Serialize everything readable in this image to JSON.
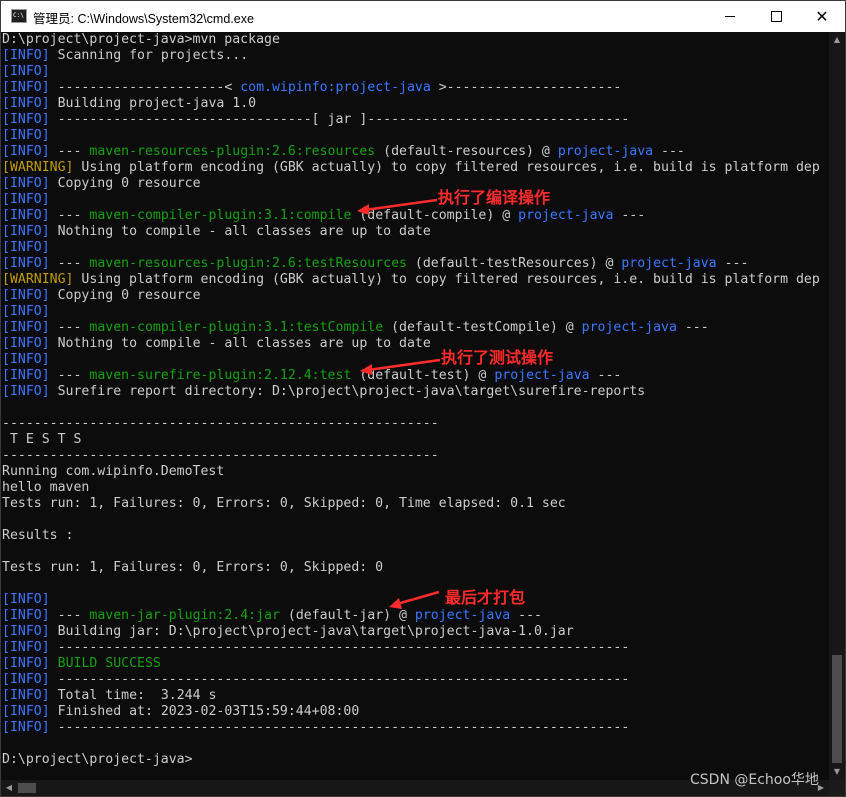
{
  "window": {
    "title": "管理员: C:\\Windows\\System32\\cmd.exe",
    "icon": "cmd-icon",
    "icon_text": "C:\\"
  },
  "colors": {
    "info_tag": "#3b78ff",
    "warning_tag": "#c19c00",
    "plugin_green": "#13a10e",
    "project_blue": "#3b78ff",
    "default_text": "#cccccc",
    "annotation_red": "#ff2b2b"
  },
  "console": {
    "lines": [
      [
        [
          "plain",
          "D:\\project\\project-java>mvn package"
        ]
      ],
      [
        [
          "bracket",
          "["
        ],
        [
          "tag",
          "INFO"
        ],
        [
          "bracket",
          "]"
        ],
        [
          "plain",
          " Scanning for projects..."
        ]
      ],
      [
        [
          "bracket",
          "["
        ],
        [
          "tag",
          "INFO"
        ],
        [
          "bracket",
          "]"
        ]
      ],
      [
        [
          "bracket",
          "["
        ],
        [
          "tag",
          "INFO"
        ],
        [
          "bracket",
          "]"
        ],
        [
          "plain",
          " ---------------------< "
        ],
        [
          "blue",
          "com.wipinfo:project-java"
        ],
        [
          "plain",
          " >----------------------"
        ]
      ],
      [
        [
          "bracket",
          "["
        ],
        [
          "tag",
          "INFO"
        ],
        [
          "bracket",
          "]"
        ],
        [
          "plain",
          " Building project-java 1.0"
        ]
      ],
      [
        [
          "bracket",
          "["
        ],
        [
          "tag",
          "INFO"
        ],
        [
          "bracket",
          "]"
        ],
        [
          "plain",
          " --------------------------------[ jar ]---------------------------------"
        ]
      ],
      [
        [
          "bracket",
          "["
        ],
        [
          "tag",
          "INFO"
        ],
        [
          "bracket",
          "]"
        ]
      ],
      [
        [
          "bracket",
          "["
        ],
        [
          "tag",
          "INFO"
        ],
        [
          "bracket",
          "]"
        ],
        [
          "plain",
          " --- "
        ],
        [
          "green",
          "maven-resources-plugin:2.6:resources"
        ],
        [
          "plain",
          " (default-resources) @ "
        ],
        [
          "blue",
          "project-java"
        ],
        [
          "plain",
          " ---"
        ]
      ],
      [
        [
          "warn",
          "[WARNING]"
        ],
        [
          "plain",
          " Using platform encoding (GBK actually) to copy filtered resources, i.e. build is platform dep"
        ]
      ],
      [
        [
          "bracket",
          "["
        ],
        [
          "tag",
          "INFO"
        ],
        [
          "bracket",
          "]"
        ],
        [
          "plain",
          " Copying 0 resource"
        ]
      ],
      [
        [
          "bracket",
          "["
        ],
        [
          "tag",
          "INFO"
        ],
        [
          "bracket",
          "]"
        ]
      ],
      [
        [
          "bracket",
          "["
        ],
        [
          "tag",
          "INFO"
        ],
        [
          "bracket",
          "]"
        ],
        [
          "plain",
          " --- "
        ],
        [
          "green",
          "maven-compiler-plugin:3.1:compile"
        ],
        [
          "plain",
          " (default-compile) @ "
        ],
        [
          "blue",
          "project-java"
        ],
        [
          "plain",
          " ---"
        ]
      ],
      [
        [
          "bracket",
          "["
        ],
        [
          "tag",
          "INFO"
        ],
        [
          "bracket",
          "]"
        ],
        [
          "plain",
          " Nothing to compile - all classes are up to date"
        ]
      ],
      [
        [
          "bracket",
          "["
        ],
        [
          "tag",
          "INFO"
        ],
        [
          "bracket",
          "]"
        ]
      ],
      [
        [
          "bracket",
          "["
        ],
        [
          "tag",
          "INFO"
        ],
        [
          "bracket",
          "]"
        ],
        [
          "plain",
          " --- "
        ],
        [
          "green",
          "maven-resources-plugin:2.6:testResources"
        ],
        [
          "plain",
          " (default-testResources) @ "
        ],
        [
          "blue",
          "project-java"
        ],
        [
          "plain",
          " ---"
        ]
      ],
      [
        [
          "warn",
          "[WARNING]"
        ],
        [
          "plain",
          " Using platform encoding (GBK actually) to copy filtered resources, i.e. build is platform dep"
        ]
      ],
      [
        [
          "bracket",
          "["
        ],
        [
          "tag",
          "INFO"
        ],
        [
          "bracket",
          "]"
        ],
        [
          "plain",
          " Copying 0 resource"
        ]
      ],
      [
        [
          "bracket",
          "["
        ],
        [
          "tag",
          "INFO"
        ],
        [
          "bracket",
          "]"
        ]
      ],
      [
        [
          "bracket",
          "["
        ],
        [
          "tag",
          "INFO"
        ],
        [
          "bracket",
          "]"
        ],
        [
          "plain",
          " --- "
        ],
        [
          "green",
          "maven-compiler-plugin:3.1:testCompile"
        ],
        [
          "plain",
          " (default-testCompile) @ "
        ],
        [
          "blue",
          "project-java"
        ],
        [
          "plain",
          " ---"
        ]
      ],
      [
        [
          "bracket",
          "["
        ],
        [
          "tag",
          "INFO"
        ],
        [
          "bracket",
          "]"
        ],
        [
          "plain",
          " Nothing to compile - all classes are up to date"
        ]
      ],
      [
        [
          "bracket",
          "["
        ],
        [
          "tag",
          "INFO"
        ],
        [
          "bracket",
          "]"
        ]
      ],
      [
        [
          "bracket",
          "["
        ],
        [
          "tag",
          "INFO"
        ],
        [
          "bracket",
          "]"
        ],
        [
          "plain",
          " --- "
        ],
        [
          "green",
          "maven-surefire-plugin:2.12.4:test"
        ],
        [
          "plain",
          " (default-test) @ "
        ],
        [
          "blue",
          "project-java"
        ],
        [
          "plain",
          " ---"
        ]
      ],
      [
        [
          "bracket",
          "["
        ],
        [
          "tag",
          "INFO"
        ],
        [
          "bracket",
          "]"
        ],
        [
          "plain",
          " Surefire report directory: D:\\project\\project-java\\target\\surefire-reports"
        ]
      ],
      [],
      [
        [
          "plain",
          "-------------------------------------------------------"
        ]
      ],
      [
        [
          "plain",
          " T E S T S"
        ]
      ],
      [
        [
          "plain",
          "-------------------------------------------------------"
        ]
      ],
      [
        [
          "plain",
          "Running com.wipinfo.DemoTest"
        ]
      ],
      [
        [
          "plain",
          "hello maven"
        ]
      ],
      [
        [
          "plain",
          "Tests run: 1, Failures: 0, Errors: 0, Skipped: 0, Time elapsed: 0.1 sec"
        ]
      ],
      [],
      [
        [
          "plain",
          "Results :"
        ]
      ],
      [],
      [
        [
          "plain",
          "Tests run: 1, Failures: 0, Errors: 0, Skipped: 0"
        ]
      ],
      [],
      [
        [
          "bracket",
          "["
        ],
        [
          "tag",
          "INFO"
        ],
        [
          "bracket",
          "]"
        ]
      ],
      [
        [
          "bracket",
          "["
        ],
        [
          "tag",
          "INFO"
        ],
        [
          "bracket",
          "]"
        ],
        [
          "plain",
          " --- "
        ],
        [
          "green",
          "maven-jar-plugin:2.4:jar"
        ],
        [
          "plain",
          " (default-jar) @ "
        ],
        [
          "blue",
          "project-java"
        ],
        [
          "plain",
          " ---"
        ]
      ],
      [
        [
          "bracket",
          "["
        ],
        [
          "tag",
          "INFO"
        ],
        [
          "bracket",
          "]"
        ],
        [
          "plain",
          " Building jar: D:\\project\\project-java\\target\\project-java-1.0.jar"
        ]
      ],
      [
        [
          "bracket",
          "["
        ],
        [
          "tag",
          "INFO"
        ],
        [
          "bracket",
          "]"
        ],
        [
          "plain",
          " ------------------------------------------------------------------------"
        ]
      ],
      [
        [
          "bracket",
          "["
        ],
        [
          "tag",
          "INFO"
        ],
        [
          "bracket",
          "]"
        ],
        [
          "plain",
          " "
        ],
        [
          "green",
          "BUILD SUCCESS"
        ]
      ],
      [
        [
          "bracket",
          "["
        ],
        [
          "tag",
          "INFO"
        ],
        [
          "bracket",
          "]"
        ],
        [
          "plain",
          " ------------------------------------------------------------------------"
        ]
      ],
      [
        [
          "bracket",
          "["
        ],
        [
          "tag",
          "INFO"
        ],
        [
          "bracket",
          "]"
        ],
        [
          "plain",
          " Total time:  3.244 s"
        ]
      ],
      [
        [
          "bracket",
          "["
        ],
        [
          "tag",
          "INFO"
        ],
        [
          "bracket",
          "]"
        ],
        [
          "plain",
          " Finished at: 2023-02-03T15:59:44+08:00"
        ]
      ],
      [
        [
          "bracket",
          "["
        ],
        [
          "tag",
          "INFO"
        ],
        [
          "bracket",
          "]"
        ],
        [
          "plain",
          " ------------------------------------------------------------------------"
        ]
      ],
      [],
      [
        [
          "plain",
          "D:\\project\\project-java>"
        ]
      ]
    ]
  },
  "annotations": {
    "compile": "执行了编译操作",
    "test": "执行了测试操作",
    "package": "最后才打包"
  },
  "watermark": "CSDN @Echoo华地"
}
